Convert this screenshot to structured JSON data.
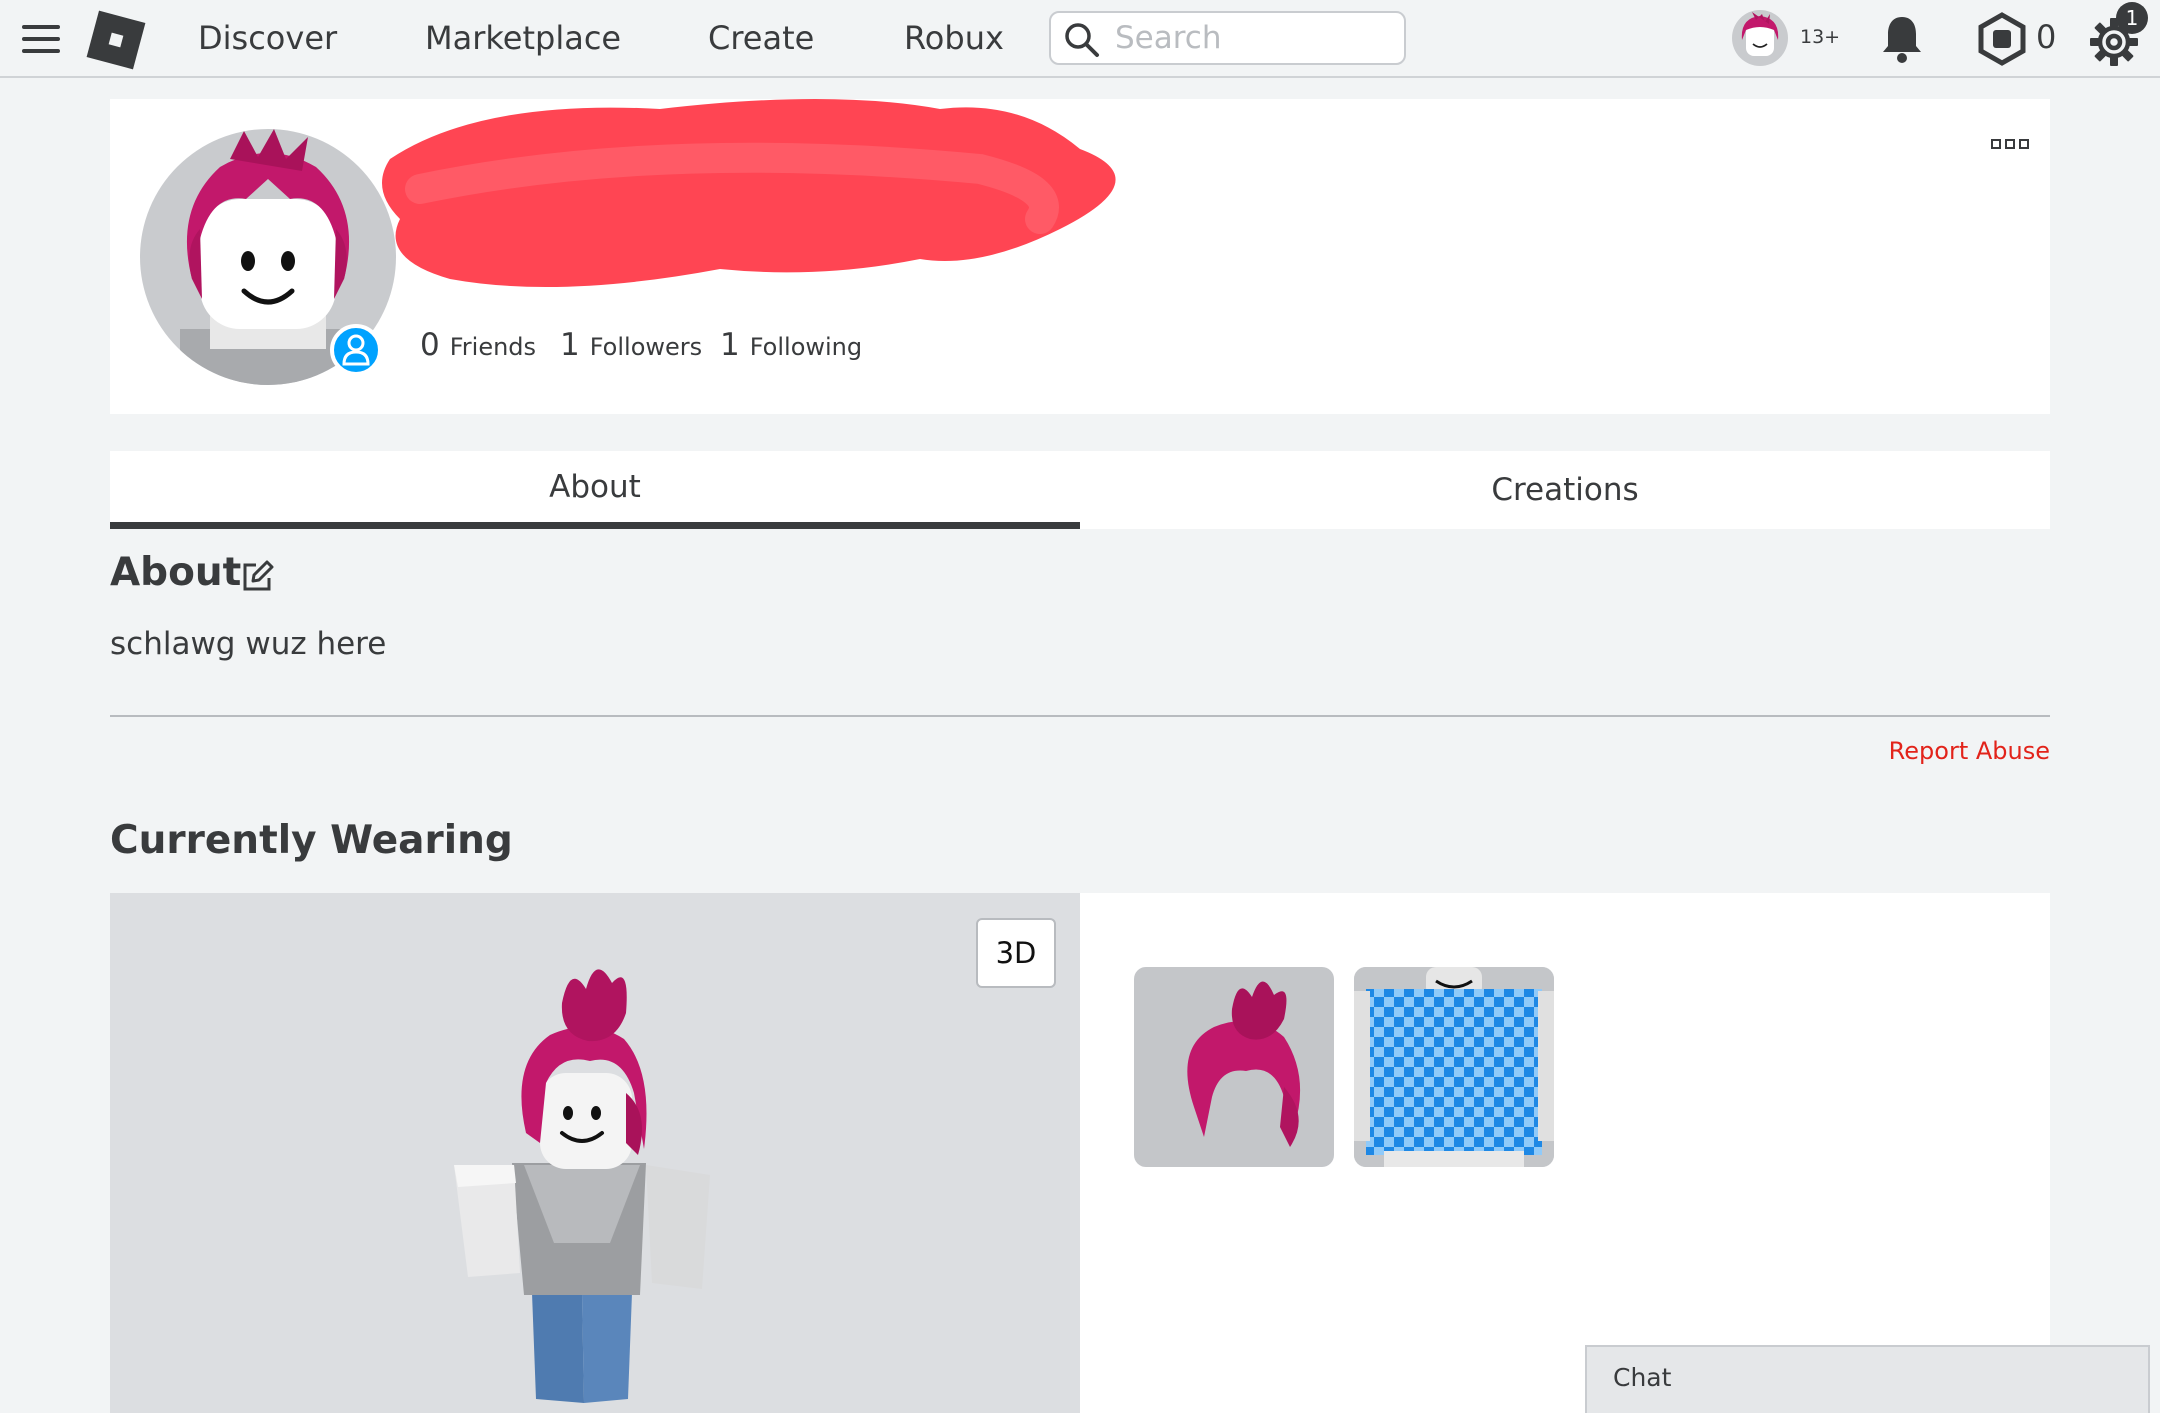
{
  "nav": {
    "links": [
      "Discover",
      "Marketplace",
      "Create",
      "Robux"
    ],
    "search_placeholder": "Search",
    "age_badge": "13+",
    "robux_count": "0",
    "settings_badge": "1"
  },
  "profile": {
    "friends_count": "0",
    "friends_label": "Friends",
    "followers_count": "1",
    "followers_label": "Followers",
    "following_count": "1",
    "following_label": "Following"
  },
  "tabs": [
    "About",
    "Creations"
  ],
  "about": {
    "heading": "About",
    "text": "schlawg wuz here",
    "report_label": "Report Abuse"
  },
  "wearing": {
    "heading": "Currently Wearing",
    "mode_button": "3D"
  },
  "chat": {
    "label": "Chat"
  },
  "colors": {
    "accent_blue": "#00a2ff",
    "report_red": "#e2231a",
    "redaction": "#ff3b4a"
  }
}
